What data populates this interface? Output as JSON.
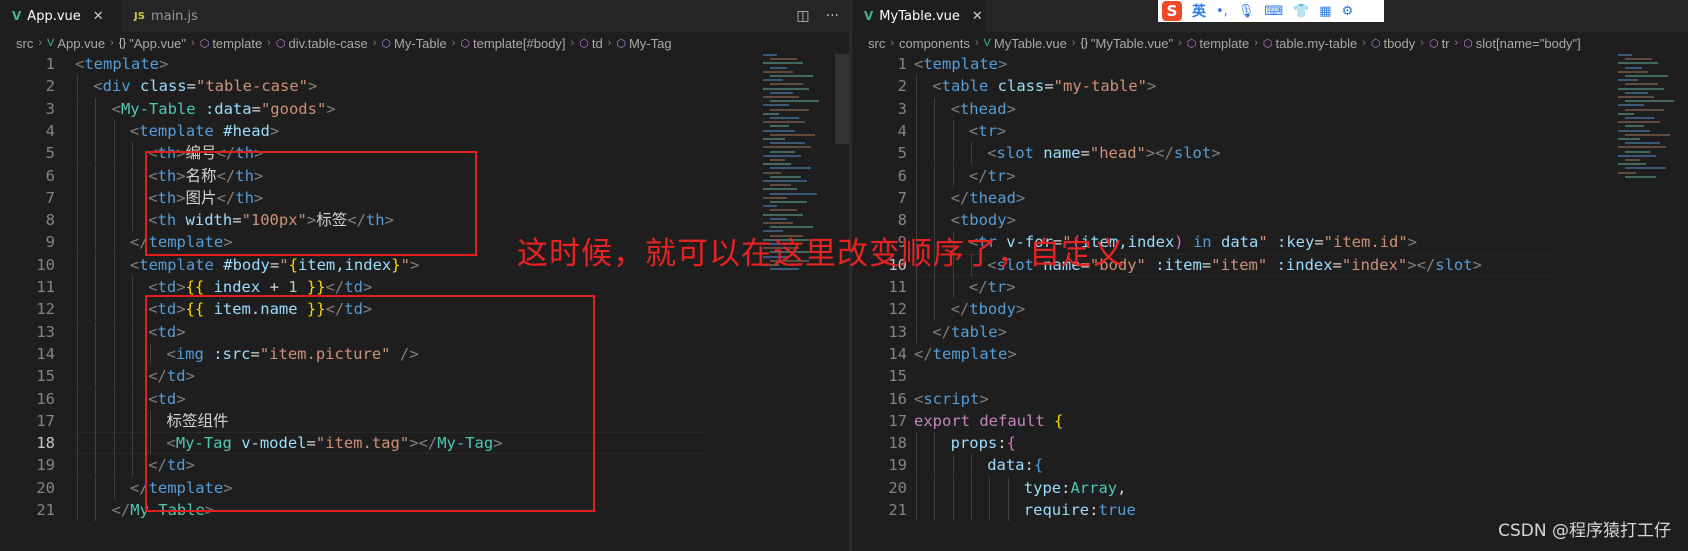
{
  "left_editor": {
    "tabs": [
      {
        "icon": "vue-file-icon",
        "label": "App.vue",
        "active": true
      },
      {
        "icon": "js-file-icon",
        "label": "main.js",
        "active": false
      }
    ],
    "breadcrumb": [
      "src",
      "App.vue",
      "\"App.vue\"",
      "template",
      "div.table-case",
      "My-Table",
      "template[#body]",
      "td",
      "My-Tag"
    ],
    "current_line": 18
  },
  "right_editor": {
    "tabs": [
      {
        "icon": "vue-file-icon",
        "label": "MyTable.vue",
        "active": true
      }
    ],
    "breadcrumb": [
      "src",
      "components",
      "MyTable.vue",
      "\"MyTable.vue\"",
      "template",
      "table.my-table",
      "tbody",
      "tr",
      "slot[name=\"body\"]"
    ],
    "current_line": 10
  },
  "annotation": "这时候，就可以在这里改变顺序了，自定义",
  "ime_toolbar": {
    "logo": "S",
    "lang": "英",
    "icons": [
      "punctuation-icon",
      "microphone-icon",
      "keyboard-icon",
      "skin-icon",
      "toolbox-icon",
      "settings-icon"
    ]
  },
  "watermark": "CSDN @程序猿打工仔",
  "colors": {
    "annotation_red": "#e02020",
    "editor_bg": "#1e1e1e",
    "tag_blue": "#569cd6",
    "component_teal": "#4ec9b0",
    "string_orange": "#ce9178",
    "attr_lightblue": "#9cdcfe"
  },
  "left_code": [
    {
      "n": "1",
      "indent": 0,
      "tokens": [
        [
          "bracket",
          "<"
        ],
        [
          "tag",
          "template"
        ],
        [
          "bracket",
          ">"
        ]
      ]
    },
    {
      "n": "2",
      "indent": 1,
      "tokens": [
        [
          "bracket",
          "<"
        ],
        [
          "tag",
          "div"
        ],
        [
          "text",
          " "
        ],
        [
          "attr",
          "class"
        ],
        [
          "text",
          "="
        ],
        [
          "str",
          "\"table-case\""
        ],
        [
          "bracket",
          ">"
        ]
      ]
    },
    {
      "n": "3",
      "indent": 2,
      "tokens": [
        [
          "bracket",
          "<"
        ],
        [
          "comp",
          "My-Table"
        ],
        [
          "text",
          " "
        ],
        [
          "attr",
          ":data"
        ],
        [
          "text",
          "="
        ],
        [
          "str",
          "\"goods\""
        ],
        [
          "bracket",
          ">"
        ]
      ]
    },
    {
      "n": "4",
      "indent": 3,
      "tokens": [
        [
          "bracket",
          "<"
        ],
        [
          "tag",
          "template"
        ],
        [
          "text",
          " "
        ],
        [
          "attr",
          "#head"
        ],
        [
          "bracket",
          ">"
        ]
      ]
    },
    {
      "n": "5",
      "indent": 4,
      "tokens": [
        [
          "bracket",
          "<"
        ],
        [
          "tag",
          "th"
        ],
        [
          "bracket",
          ">"
        ],
        [
          "text",
          "编号"
        ],
        [
          "bracket",
          "</"
        ],
        [
          "tag",
          "th"
        ],
        [
          "bracket",
          ">"
        ]
      ]
    },
    {
      "n": "6",
      "indent": 4,
      "tokens": [
        [
          "bracket",
          "<"
        ],
        [
          "tag",
          "th"
        ],
        [
          "bracket",
          ">"
        ],
        [
          "text",
          "名称"
        ],
        [
          "bracket",
          "</"
        ],
        [
          "tag",
          "th"
        ],
        [
          "bracket",
          ">"
        ]
      ]
    },
    {
      "n": "7",
      "indent": 4,
      "tokens": [
        [
          "bracket",
          "<"
        ],
        [
          "tag",
          "th"
        ],
        [
          "bracket",
          ">"
        ],
        [
          "text",
          "图片"
        ],
        [
          "bracket",
          "</"
        ],
        [
          "tag",
          "th"
        ],
        [
          "bracket",
          ">"
        ]
      ]
    },
    {
      "n": "8",
      "indent": 4,
      "tokens": [
        [
          "bracket",
          "<"
        ],
        [
          "tag",
          "th"
        ],
        [
          "text",
          " "
        ],
        [
          "attr",
          "width"
        ],
        [
          "text",
          "="
        ],
        [
          "str",
          "\"100px\""
        ],
        [
          "bracket",
          ">"
        ],
        [
          "text",
          "标签"
        ],
        [
          "bracket",
          "</"
        ],
        [
          "tag",
          "th"
        ],
        [
          "bracket",
          ">"
        ]
      ]
    },
    {
      "n": "9",
      "indent": 3,
      "tokens": [
        [
          "bracket",
          "</"
        ],
        [
          "tag",
          "template"
        ],
        [
          "bracket",
          ">"
        ]
      ]
    },
    {
      "n": "10",
      "indent": 3,
      "tokens": [
        [
          "bracket",
          "<"
        ],
        [
          "tag",
          "template"
        ],
        [
          "text",
          " "
        ],
        [
          "attr",
          "#body"
        ],
        [
          "text",
          "="
        ],
        [
          "str",
          "\""
        ],
        [
          "bra",
          "{"
        ],
        [
          "var",
          "item,index"
        ],
        [
          "bra",
          "}"
        ],
        [
          "str",
          "\""
        ],
        [
          "bracket",
          ">"
        ]
      ]
    },
    {
      "n": "11",
      "indent": 4,
      "tokens": [
        [
          "bracket",
          "<"
        ],
        [
          "tag",
          "td"
        ],
        [
          "bracket",
          ">"
        ],
        [
          "mus",
          "{{"
        ],
        [
          "text",
          " "
        ],
        [
          "var",
          "index"
        ],
        [
          "text",
          " + "
        ],
        [
          "num",
          "1"
        ],
        [
          "text",
          " "
        ],
        [
          "mus",
          "}}"
        ],
        [
          "bracket",
          "</"
        ],
        [
          "tag",
          "td"
        ],
        [
          "bracket",
          ">"
        ]
      ]
    },
    {
      "n": "12",
      "indent": 4,
      "tokens": [
        [
          "bracket",
          "<"
        ],
        [
          "tag",
          "td"
        ],
        [
          "bracket",
          ">"
        ],
        [
          "mus",
          "{{"
        ],
        [
          "text",
          " "
        ],
        [
          "var",
          "item"
        ],
        [
          "text",
          "."
        ],
        [
          "var",
          "name"
        ],
        [
          "text",
          " "
        ],
        [
          "mus",
          "}}"
        ],
        [
          "bracket",
          "</"
        ],
        [
          "tag",
          "td"
        ],
        [
          "bracket",
          ">"
        ]
      ]
    },
    {
      "n": "13",
      "indent": 4,
      "tokens": [
        [
          "bracket",
          "<"
        ],
        [
          "tag",
          "td"
        ],
        [
          "bracket",
          ">"
        ]
      ]
    },
    {
      "n": "14",
      "indent": 5,
      "tokens": [
        [
          "bracket",
          "<"
        ],
        [
          "tag",
          "img"
        ],
        [
          "text",
          " "
        ],
        [
          "attr",
          ":src"
        ],
        [
          "text",
          "="
        ],
        [
          "str",
          "\"item.picture\""
        ],
        [
          "text",
          " "
        ],
        [
          "bracket",
          "/>"
        ]
      ]
    },
    {
      "n": "15",
      "indent": 4,
      "tokens": [
        [
          "bracket",
          "</"
        ],
        [
          "tag",
          "td"
        ],
        [
          "bracket",
          ">"
        ]
      ]
    },
    {
      "n": "16",
      "indent": 4,
      "tokens": [
        [
          "bracket",
          "<"
        ],
        [
          "tag",
          "td"
        ],
        [
          "bracket",
          ">"
        ]
      ]
    },
    {
      "n": "17",
      "indent": 5,
      "tokens": [
        [
          "text",
          "标签组件"
        ]
      ]
    },
    {
      "n": "18",
      "indent": 5,
      "tokens": [
        [
          "bracket",
          "<"
        ],
        [
          "comp",
          "My-Tag"
        ],
        [
          "text",
          " "
        ],
        [
          "attr",
          "v-model"
        ],
        [
          "text",
          "="
        ],
        [
          "str",
          "\"item.tag\""
        ],
        [
          "bracket",
          ">"
        ],
        [
          "bracket",
          "</"
        ],
        [
          "comp",
          "My-Tag"
        ],
        [
          "bracket",
          ">"
        ]
      ]
    },
    {
      "n": "19",
      "indent": 4,
      "tokens": [
        [
          "bracket",
          "</"
        ],
        [
          "tag",
          "td"
        ],
        [
          "bracket",
          ">"
        ]
      ]
    },
    {
      "n": "20",
      "indent": 3,
      "tokens": [
        [
          "bracket",
          "</"
        ],
        [
          "tag",
          "template"
        ],
        [
          "bracket",
          ">"
        ]
      ]
    },
    {
      "n": "21",
      "indent": 2,
      "tokens": [
        [
          "bracket",
          "</"
        ],
        [
          "comp",
          "My-Table"
        ],
        [
          "bracket",
          ">"
        ]
      ]
    }
  ],
  "right_code": [
    {
      "n": "1",
      "indent": 0,
      "tokens": [
        [
          "bracket",
          "<"
        ],
        [
          "tag",
          "template"
        ],
        [
          "bracket",
          ">"
        ]
      ]
    },
    {
      "n": "2",
      "indent": 1,
      "tokens": [
        [
          "bracket",
          "<"
        ],
        [
          "tag",
          "table"
        ],
        [
          "text",
          " "
        ],
        [
          "attr",
          "class"
        ],
        [
          "text",
          "="
        ],
        [
          "str",
          "\"my-table\""
        ],
        [
          "bracket",
          ">"
        ]
      ]
    },
    {
      "n": "3",
      "indent": 2,
      "tokens": [
        [
          "bracket",
          "<"
        ],
        [
          "tag",
          "thead"
        ],
        [
          "bracket",
          ">"
        ]
      ]
    },
    {
      "n": "4",
      "indent": 3,
      "tokens": [
        [
          "bracket",
          "<"
        ],
        [
          "tag",
          "tr"
        ],
        [
          "bracket",
          ">"
        ]
      ]
    },
    {
      "n": "5",
      "indent": 4,
      "tokens": [
        [
          "bracket",
          "<"
        ],
        [
          "tag",
          "slot"
        ],
        [
          "text",
          " "
        ],
        [
          "attr",
          "name"
        ],
        [
          "text",
          "="
        ],
        [
          "str",
          "\"head\""
        ],
        [
          "bracket",
          "></"
        ],
        [
          "tag",
          "slot"
        ],
        [
          "bracket",
          ">"
        ]
      ]
    },
    {
      "n": "6",
      "indent": 3,
      "tokens": [
        [
          "bracket",
          "</"
        ],
        [
          "tag",
          "tr"
        ],
        [
          "bracket",
          ">"
        ]
      ]
    },
    {
      "n": "7",
      "indent": 2,
      "tokens": [
        [
          "bracket",
          "</"
        ],
        [
          "tag",
          "thead"
        ],
        [
          "bracket",
          ">"
        ]
      ]
    },
    {
      "n": "8",
      "indent": 2,
      "tokens": [
        [
          "bracket",
          "<"
        ],
        [
          "tag",
          "tbody"
        ],
        [
          "bracket",
          ">"
        ]
      ]
    },
    {
      "n": "9",
      "indent": 3,
      "tokens": [
        [
          "bracket",
          "<"
        ],
        [
          "tag",
          "tr"
        ],
        [
          "text",
          " "
        ],
        [
          "attr",
          "v-for"
        ],
        [
          "text",
          "="
        ],
        [
          "str",
          "\""
        ],
        [
          "par",
          "("
        ],
        [
          "var",
          "item,index"
        ],
        [
          "par",
          ")"
        ],
        [
          "text",
          " "
        ],
        [
          "kw2",
          "in"
        ],
        [
          "text",
          " "
        ],
        [
          "var",
          "data"
        ],
        [
          "str",
          "\""
        ],
        [
          "text",
          " "
        ],
        [
          "attr",
          ":key"
        ],
        [
          "text",
          "="
        ],
        [
          "str",
          "\"item.id\""
        ],
        [
          "bracket",
          ">"
        ]
      ]
    },
    {
      "n": "10",
      "indent": 4,
      "tokens": [
        [
          "bracket",
          "<"
        ],
        [
          "tag",
          "slot"
        ],
        [
          "text",
          " "
        ],
        [
          "attr",
          "name"
        ],
        [
          "text",
          "="
        ],
        [
          "str",
          "\"body\""
        ],
        [
          "text",
          " "
        ],
        [
          "attr",
          ":item"
        ],
        [
          "text",
          "="
        ],
        [
          "str",
          "\"item\""
        ],
        [
          "text",
          " "
        ],
        [
          "attr",
          ":index"
        ],
        [
          "text",
          "="
        ],
        [
          "str",
          "\"index\""
        ],
        [
          "bracket",
          "></"
        ],
        [
          "tag",
          "slot"
        ],
        [
          "bracket",
          ">"
        ]
      ]
    },
    {
      "n": "11",
      "indent": 3,
      "tokens": [
        [
          "bracket",
          "</"
        ],
        [
          "tag",
          "tr"
        ],
        [
          "bracket",
          ">"
        ]
      ]
    },
    {
      "n": "12",
      "indent": 2,
      "tokens": [
        [
          "bracket",
          "</"
        ],
        [
          "tag",
          "tbody"
        ],
        [
          "bracket",
          ">"
        ]
      ]
    },
    {
      "n": "13",
      "indent": 1,
      "tokens": [
        [
          "bracket",
          "</"
        ],
        [
          "tag",
          "table"
        ],
        [
          "bracket",
          ">"
        ]
      ]
    },
    {
      "n": "14",
      "indent": 0,
      "tokens": [
        [
          "bracket",
          "</"
        ],
        [
          "tag",
          "template"
        ],
        [
          "bracket",
          ">"
        ]
      ]
    },
    {
      "n": "15",
      "indent": 0,
      "tokens": []
    },
    {
      "n": "16",
      "indent": 0,
      "tokens": [
        [
          "bracket",
          "<"
        ],
        [
          "tag",
          "script"
        ],
        [
          "bracket",
          ">"
        ]
      ]
    },
    {
      "n": "17",
      "indent": 0,
      "tokens": [
        [
          "kw",
          "export"
        ],
        [
          "text",
          " "
        ],
        [
          "kw",
          "default"
        ],
        [
          "text",
          " "
        ],
        [
          "bra",
          "{"
        ]
      ]
    },
    {
      "n": "18",
      "indent": 2,
      "tokens": [
        [
          "attr",
          "props"
        ],
        [
          "text",
          ":"
        ],
        [
          "par",
          "{"
        ]
      ]
    },
    {
      "n": "19",
      "indent": 4,
      "tokens": [
        [
          "attr",
          "data"
        ],
        [
          "text",
          ":"
        ],
        [
          "kw2",
          "{"
        ]
      ]
    },
    {
      "n": "20",
      "indent": 6,
      "tokens": [
        [
          "attr",
          "type"
        ],
        [
          "text",
          ":"
        ],
        [
          "comp",
          "Array"
        ],
        [
          "text",
          ","
        ]
      ]
    },
    {
      "n": "21",
      "indent": 6,
      "tokens": [
        [
          "attr",
          "require"
        ],
        [
          "text",
          ":"
        ],
        [
          "kw2",
          "true"
        ]
      ]
    }
  ]
}
